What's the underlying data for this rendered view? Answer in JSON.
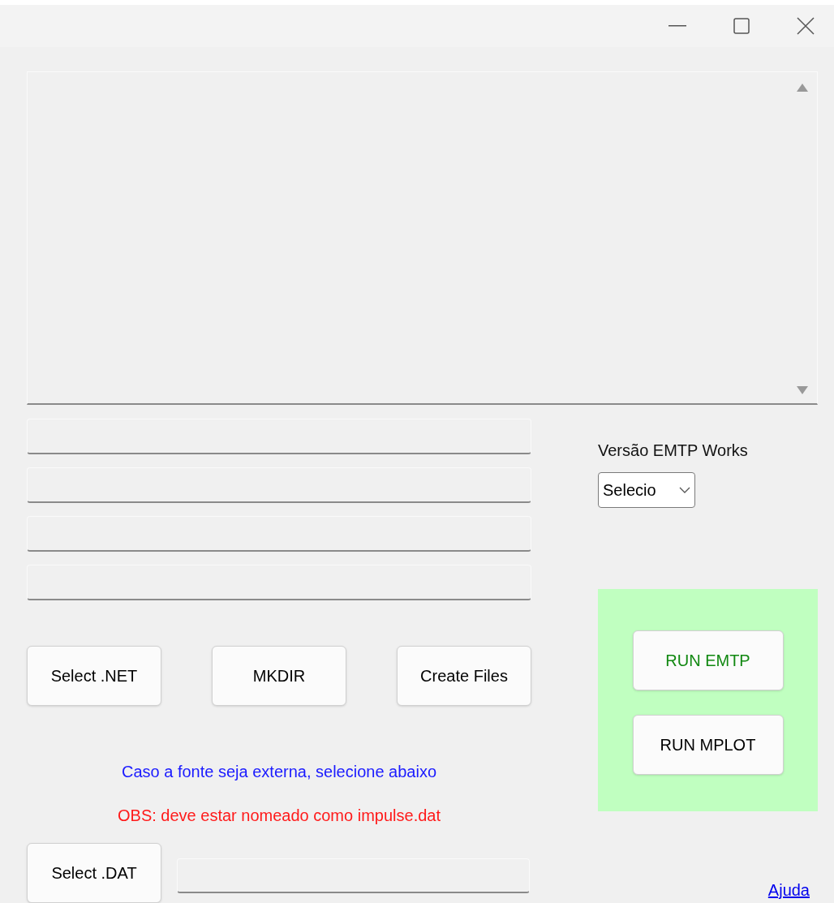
{
  "path_fields": [
    {
      "kind": "text"
    },
    {
      "kind": "text"
    },
    {
      "kind": "text"
    },
    {
      "kind": "text"
    }
  ],
  "version": {
    "label": "Versão EMTP Works",
    "value": "Selecio"
  },
  "buttons": [
    {
      "label": "Select .NET"
    },
    {
      "label": "MKDIR"
    },
    {
      "label": "Create Files"
    }
  ],
  "run_panel": {
    "buttons": [
      {
        "label": "RUN EMTP",
        "color": "#118811"
      },
      {
        "label": "RUN MPLOT",
        "color": "#000000"
      }
    ]
  },
  "notes": [
    {
      "text": "Caso a fonte seja externa, selecione abaixo",
      "color": "#1a1aff"
    },
    {
      "text": "OBS: deve estar nomeado como impulse.dat",
      "color": "#ff1a1a"
    }
  ],
  "dat": {
    "button": "Select .DAT"
  },
  "help_link": "Ajuda"
}
